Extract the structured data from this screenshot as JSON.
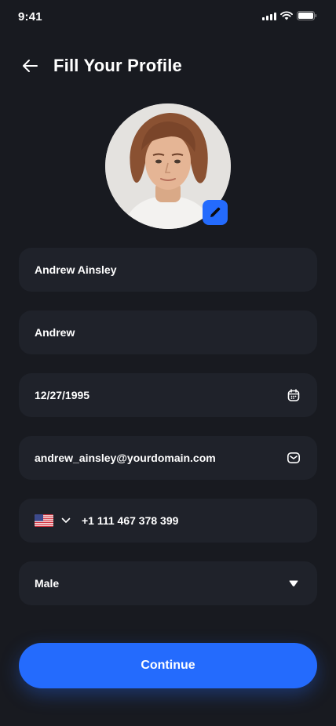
{
  "status_bar": {
    "time": "9:41"
  },
  "header": {
    "title": "Fill Your Profile"
  },
  "form": {
    "full_name": "Andrew Ainsley",
    "nickname": "Andrew",
    "date_of_birth": "12/27/1995",
    "email": "andrew_ainsley@yourdomain.com",
    "phone": "+1 111 467 378 399",
    "gender": "Male"
  },
  "actions": {
    "continue_label": "Continue"
  },
  "colors": {
    "background": "#181a20",
    "field_bg": "#1f222a",
    "accent": "#246bfd"
  }
}
